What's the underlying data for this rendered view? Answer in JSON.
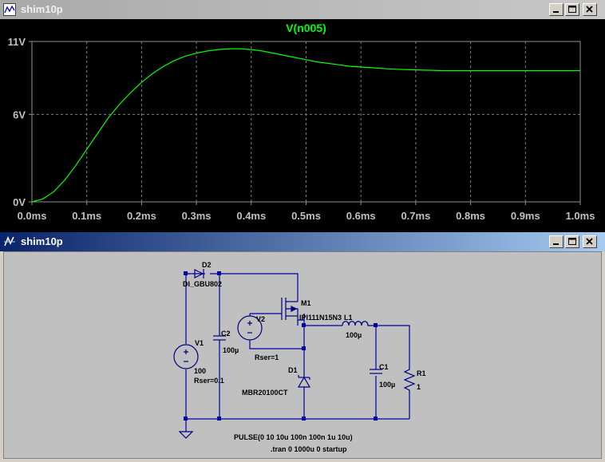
{
  "plot_window": {
    "title": "shim10p"
  },
  "schematic_window": {
    "title": "shim10p"
  },
  "chart_data": {
    "type": "line",
    "title": "V(n005)",
    "xlabel": "",
    "ylabel": "",
    "xlim": [
      0,
      1.0
    ],
    "ylim": [
      0,
      11
    ],
    "x_ticks": [
      "0.0ms",
      "0.1ms",
      "0.2ms",
      "0.3ms",
      "0.4ms",
      "0.5ms",
      "0.6ms",
      "0.7ms",
      "0.8ms",
      "0.9ms",
      "1.0ms"
    ],
    "y_ticks": [
      "0V",
      "6V",
      "11V"
    ],
    "grid": true,
    "line_color": "#00ff00",
    "series": [
      {
        "name": "V(n005)",
        "x": [
          0,
          0.02,
          0.04,
          0.06,
          0.08,
          0.1,
          0.12,
          0.14,
          0.16,
          0.18,
          0.2,
          0.22,
          0.24,
          0.26,
          0.28,
          0.3,
          0.32,
          0.34,
          0.36,
          0.38,
          0.4,
          0.42,
          0.44,
          0.46,
          0.48,
          0.5,
          0.52,
          0.54,
          0.56,
          0.58,
          0.6,
          0.62,
          0.64,
          0.66,
          0.68,
          0.7,
          0.75,
          0.8,
          0.85,
          0.9,
          0.95,
          1.0
        ],
        "y": [
          0,
          0.2,
          0.7,
          1.5,
          2.5,
          3.6,
          4.7,
          5.8,
          6.7,
          7.5,
          8.2,
          8.8,
          9.3,
          9.7,
          10.0,
          10.2,
          10.35,
          10.45,
          10.5,
          10.5,
          10.45,
          10.35,
          10.2,
          10.05,
          9.9,
          9.75,
          9.6,
          9.5,
          9.4,
          9.3,
          9.25,
          9.2,
          9.15,
          9.1,
          9.08,
          9.05,
          9.0,
          9.0,
          9.0,
          9.0,
          9.0,
          9.0
        ]
      }
    ]
  },
  "schematic": {
    "labels": {
      "d2": "D2",
      "d2_model": "DI_GBU802",
      "m1": "M1",
      "m1_model": "IPI111N15N3",
      "v2": "V2",
      "c2": "C2",
      "c2_val": "100µ",
      "v1": "V1",
      "v1_val": "100",
      "v1_rser": "Rser=0.1",
      "rser1": "Rser=1",
      "l1": "L1",
      "l1_val": "100µ",
      "d1": "D1",
      "d1_model": "MBR20100CT",
      "c1": "C1",
      "c1_val": "100µ",
      "r1": "R1",
      "r1_val": "1",
      "pulse": "PULSE(0 10 10u 100n 100n 1u 10u)",
      "tran": ".tran 0 1000u 0 startup"
    }
  }
}
